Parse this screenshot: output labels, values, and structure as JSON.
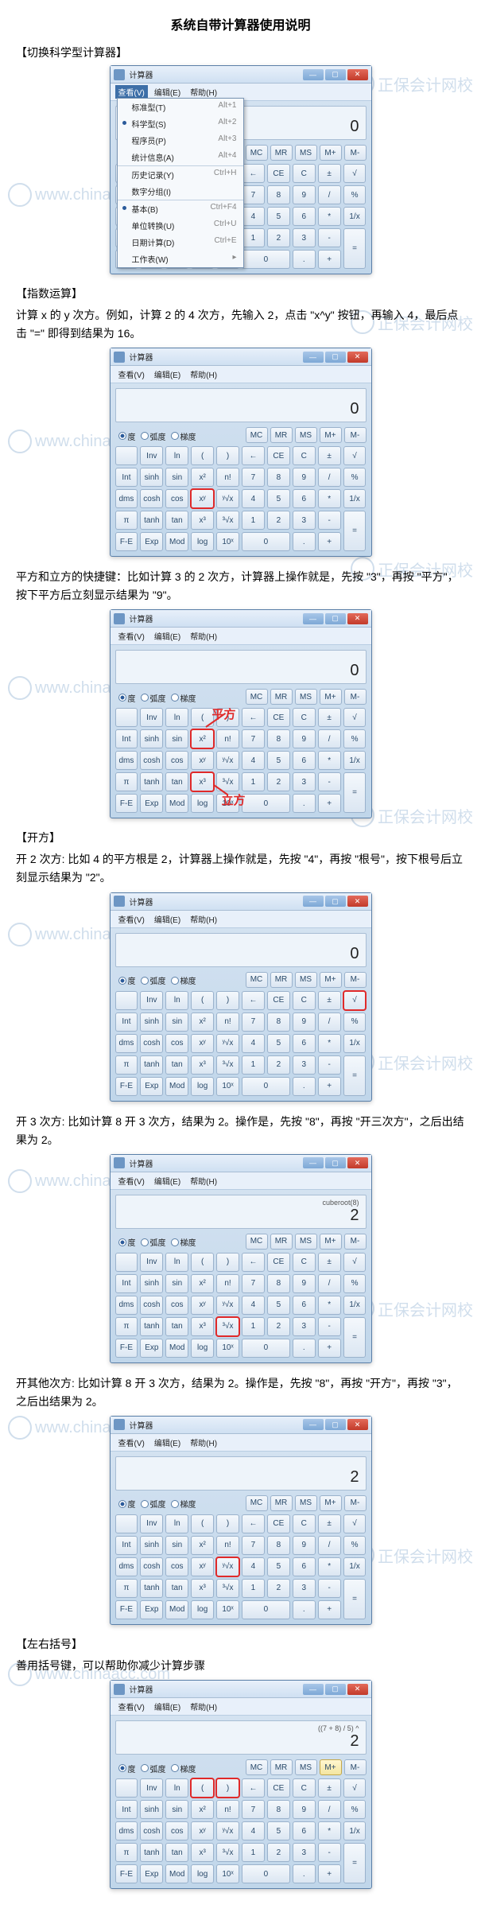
{
  "doc_title": "系统自带计算器使用说明",
  "watermark": "正保会计网校",
  "watermark_url": "www.chinaacc.com",
  "sections": {
    "s1_title": "【切换科学型计算器】",
    "s2_title": "【指数运算】",
    "s2_p1": "计算 x 的 y 次方。例如，计算 2 的 4 次方，先输入 2，点击 \"x^y\" 按钮，再输入 4，最后点击 \"=\" 即得到结果为 16。",
    "s2_p2": "平方和立方的快捷键：比如计算 3 的 2 次方，计算器上操作就是，先按 \"3\"，再按 \"平方\"，按下平方后立刻显示结果为 \"9\"。",
    "s3_title": "【开方】",
    "s3_p1": "开 2 次方: 比如 4 的平方根是 2，计算器上操作就是，先按 \"4\"，再按 \"根号\"，按下根号后立刻显示结果为 \"2\"。",
    "s3_p2": "开 3 次方: 比如计算 8 开 3 次方，结果为 2。操作是，先按 \"8\"，再按 \"开三次方\"，之后出结果为 2。",
    "s3_p3": "开其他次方: 比如计算 8 开 3 次方，结果为 2。操作是，先按 \"8\"，再按 \"开方\"，再按 \"3\"，之后出结果为 2。",
    "s4_title": "【左右括号】",
    "s4_p1": "善用括号键，可以帮助你减少计算步骤"
  },
  "calc": {
    "title": "计算器",
    "menu_view": "查看(V)",
    "menu_edit": "编辑(E)",
    "menu_help": "帮助(H)",
    "deg": "度",
    "rad": "弧度",
    "grad": "梯度",
    "mem": [
      "MC",
      "MR",
      "MS",
      "M+",
      "M-"
    ],
    "rows": [
      [
        "",
        "Inv",
        "ln",
        "(",
        ")",
        "←",
        "CE",
        "C",
        "±",
        "√"
      ],
      [
        "Int",
        "sinh",
        "sin",
        "x²",
        "n!",
        "7",
        "8",
        "9",
        "/",
        "%"
      ],
      [
        "dms",
        "cosh",
        "cos",
        "xʸ",
        "ʸ√x",
        "4",
        "5",
        "6",
        "*",
        "1/x"
      ],
      [
        "π",
        "tanh",
        "tan",
        "x³",
        "³√x",
        "1",
        "2",
        "3",
        "-",
        "="
      ],
      [
        "F-E",
        "Exp",
        "Mod",
        "log",
        "10ˣ",
        "0",
        "",
        ".",
        "+",
        ""
      ]
    ],
    "dropdown": [
      {
        "l": "标准型(T)",
        "r": "Alt+1"
      },
      {
        "l": "科学型(S)",
        "r": "Alt+2",
        "dot": true
      },
      {
        "l": "程序员(P)",
        "r": "Alt+3"
      },
      {
        "l": "统计信息(A)",
        "r": "Alt+4"
      },
      {
        "l": "历史记录(Y)",
        "r": "Ctrl+H",
        "sep": true
      },
      {
        "l": "数字分组(I)",
        "r": ""
      },
      {
        "l": "基本(B)",
        "r": "Ctrl+F4",
        "sep": true,
        "dot": true
      },
      {
        "l": "单位转换(U)",
        "r": "Ctrl+U"
      },
      {
        "l": "日期计算(D)",
        "r": "Ctrl+E"
      },
      {
        "l": "工作表(W)",
        "r": "▸"
      }
    ]
  },
  "displays": {
    "d1": "0",
    "d2": "0",
    "d3": "0",
    "d4": "0",
    "d5_expr": "cuberoot(8)",
    "d5": "2",
    "d6": "2",
    "d7_expr": "((7 + 8) / 5) ^",
    "d7": "2"
  },
  "anno": {
    "pingfang": "平方",
    "lifang": "立方"
  }
}
